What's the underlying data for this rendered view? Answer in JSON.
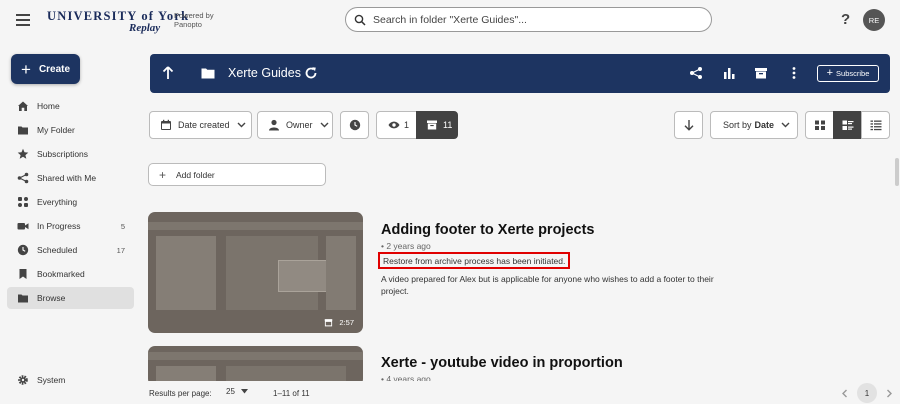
{
  "brand": {
    "logo_line1": "UNIVERSITY of York",
    "logo_line2": "Replay",
    "powered_line1": "Powered by",
    "powered_line2": "Panopto",
    "accent_color": "#1d3461"
  },
  "search": {
    "placeholder": "Search in folder \"Xerte Guides\"..."
  },
  "header": {
    "help_label": "?",
    "user_initials": "RE"
  },
  "sidebar": {
    "create_label": "Create",
    "items": [
      {
        "label": "Home",
        "icon": "home-icon"
      },
      {
        "label": "My Folder",
        "icon": "folder-icon"
      },
      {
        "label": "Subscriptions",
        "icon": "star-icon"
      },
      {
        "label": "Shared with Me",
        "icon": "share-icon"
      },
      {
        "label": "Everything",
        "icon": "grid-icon"
      },
      {
        "label": "In Progress",
        "icon": "video-camera-icon",
        "count": "5"
      },
      {
        "label": "Scheduled",
        "icon": "clock-icon",
        "count": "17"
      },
      {
        "label": "Bookmarked",
        "icon": "bookmark-icon"
      },
      {
        "label": "Browse",
        "icon": "folder-icon",
        "active": true
      }
    ],
    "system_label": "System"
  },
  "folder": {
    "title": "Xerte Guides",
    "subscribe_label": "Subscribe"
  },
  "filters": {
    "date_label": "Date created",
    "owner_label": "Owner",
    "viewed_count": "1",
    "archived_count": "11",
    "sort_prefix": "Sort by",
    "sort_value": "Date"
  },
  "add_folder_label": "Add folder",
  "sessions": [
    {
      "title": "Adding footer to Xerte projects",
      "age": "• 2 years ago",
      "status": "Restore from archive process has been initiated.",
      "description": "A video prepared for Alex but is applicable for anyone who wishes to add a footer to their project.",
      "duration": "2:57"
    },
    {
      "title": "Xerte - youtube video in proportion",
      "age": "• 4 years ago"
    }
  ],
  "footer": {
    "results_label": "Results per page:",
    "per_page": "25",
    "range": "1–11 of 11",
    "page": "1"
  }
}
